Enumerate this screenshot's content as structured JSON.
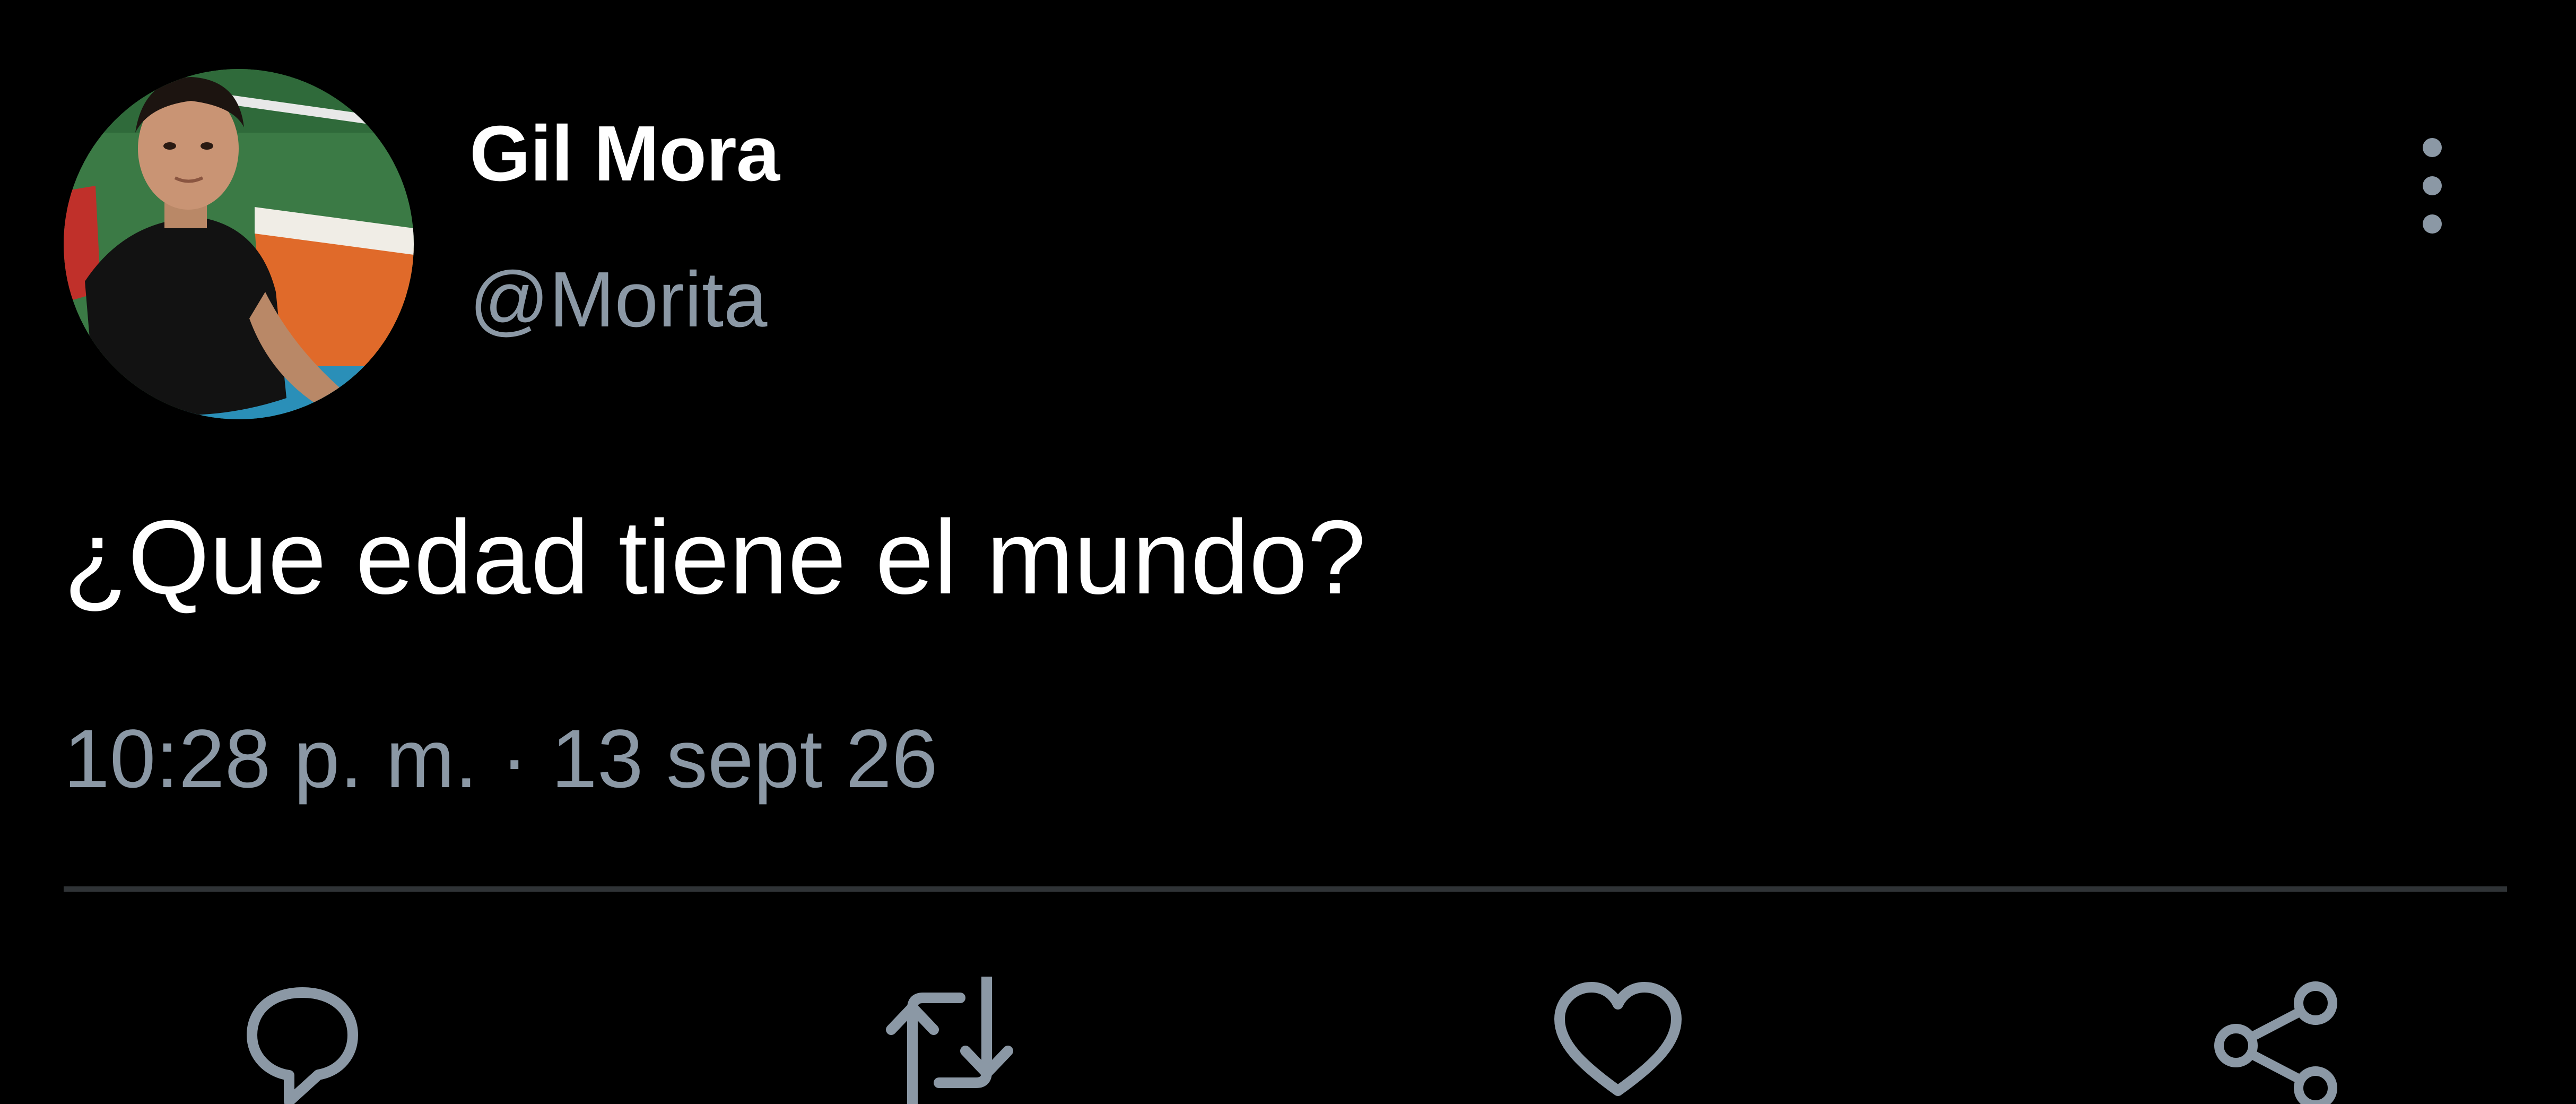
{
  "tweet": {
    "display_name": "Gil Mora",
    "handle": "@Morita",
    "text": "¿Que edad tiene el mundo?",
    "time": "10:28 p. m.",
    "separator": "·",
    "date": "13 sept 26"
  },
  "icons": {
    "more": "more-vertical-icon",
    "reply": "reply-icon",
    "retweet": "retweet-icon",
    "like": "heart-icon",
    "share": "share-icon"
  },
  "colors": {
    "background": "#000000",
    "primary_text": "#ffffff",
    "secondary_text": "#8b98a5",
    "divider": "#2f3336"
  }
}
